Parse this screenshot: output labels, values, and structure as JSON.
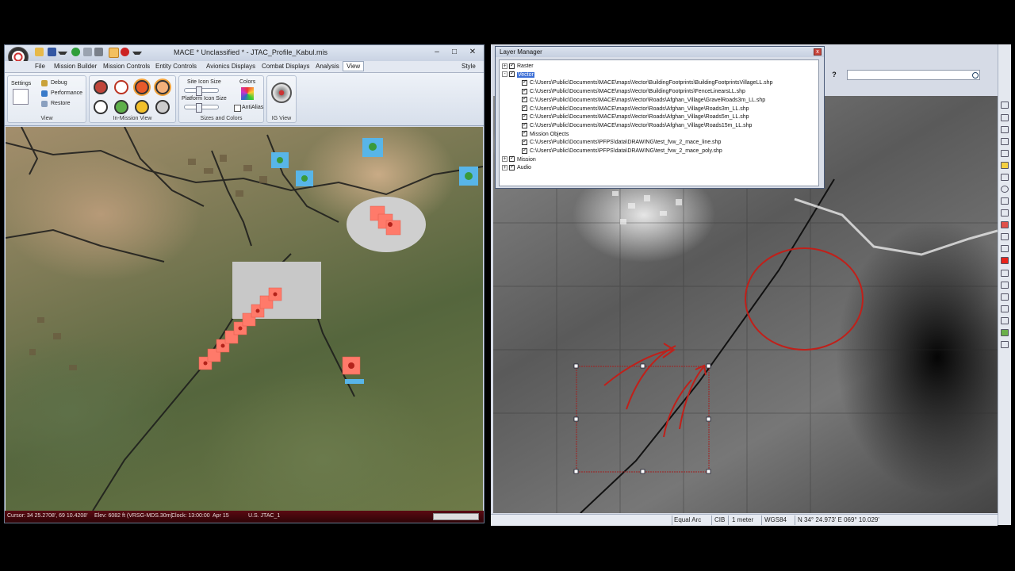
{
  "left_window": {
    "title": "MACE * Unclassified * - JTAC_Profile_Kabul.mis",
    "window_controls": {
      "minimize": "–",
      "restore": "□",
      "close": "✕"
    },
    "menu": [
      "File",
      "Mission Builder",
      "Mission Controls",
      "Entity Controls",
      "Avionics Displays",
      "Combat Displays",
      "Analysis",
      "View"
    ],
    "menu_active": "View",
    "style_label": "Style",
    "ribbon": {
      "view_group": {
        "label": "View",
        "settings": "Settings",
        "debug": "Debug",
        "performance": "Performance",
        "restore": "Restore"
      },
      "inmission_group": {
        "label": "In-Mission View"
      },
      "sizes_group": {
        "label": "Sizes and Colors",
        "site_icon_size": "Site Icon Size",
        "platform_icon_size": "Platform Icon Size",
        "colors": "Colors",
        "antialias": "AntiAlias"
      },
      "ig_group": {
        "label": "IG View"
      }
    },
    "status": {
      "cursor": "Cursor: 34 25.2708', 69 10.4208'",
      "elev": "Elev: 6082 ft (VRSG-MDS.30m)",
      "clock": "Clock: 13:00:00",
      "date": "Apr 15",
      "unit": "U.S. JTAC_1"
    }
  },
  "layer_manager": {
    "title": "Layer Manager",
    "close": "x",
    "tree": [
      {
        "label": "Raster",
        "level": 0,
        "expander": "+",
        "checked": true
      },
      {
        "label": "Vector",
        "level": 0,
        "expander": "-",
        "checked": true,
        "selected": true
      },
      {
        "label": "C:\\Users\\Public\\Documents\\MACE\\maps\\Vector\\BuildingFootprints\\BuildingFootprintsVillageLL.shp",
        "level": 1,
        "checked": true
      },
      {
        "label": "C:\\Users\\Public\\Documents\\MACE\\maps\\Vector\\BuildingFootprints\\FenceLinearsLL.shp",
        "level": 1,
        "checked": true
      },
      {
        "label": "C:\\Users\\Public\\Documents\\MACE\\maps\\Vector\\Roads\\Afghan_Village\\GravelRoads3m_LL.shp",
        "level": 1,
        "checked": true
      },
      {
        "label": "C:\\Users\\Public\\Documents\\MACE\\maps\\Vector\\Roads\\Afghan_Village\\Roads3m_LL.shp",
        "level": 1,
        "checked": true
      },
      {
        "label": "C:\\Users\\Public\\Documents\\MACE\\maps\\Vector\\Roads\\Afghan_Village\\Roads5m_LL.shp",
        "level": 1,
        "checked": true
      },
      {
        "label": "C:\\Users\\Public\\Documents\\MACE\\maps\\Vector\\Roads\\Afghan_Village\\Roads15m_LL.shp",
        "level": 1,
        "checked": true
      },
      {
        "label": "Mission Objects",
        "level": 1,
        "checked": true
      },
      {
        "label": "C:\\Users\\Public\\Documents\\PFPS\\data\\DRAWING\\test_fvw_2_mace_line.shp",
        "level": 1,
        "checked": true
      },
      {
        "label": "C:\\Users\\Public\\Documents\\PFPS\\data\\DRAWING\\test_fvw_2_mace_poly.shp",
        "level": 1,
        "checked": true
      },
      {
        "label": "Mission",
        "level": 0,
        "expander": "+",
        "checked": true
      },
      {
        "label": "Audio",
        "level": 0,
        "expander": "+",
        "checked": true
      }
    ]
  },
  "right_window": {
    "help_icon_text": "?",
    "status": {
      "projection": "Equal Arc",
      "source": "CIB",
      "scale": "1 meter",
      "datum": "WGS84",
      "coords": "N 34° 24.973'  E 069° 10.029'"
    },
    "colors": {
      "annotation_red": "#c0201a",
      "selection_box": "#a02020",
      "status_bar": "#3a060b"
    }
  }
}
